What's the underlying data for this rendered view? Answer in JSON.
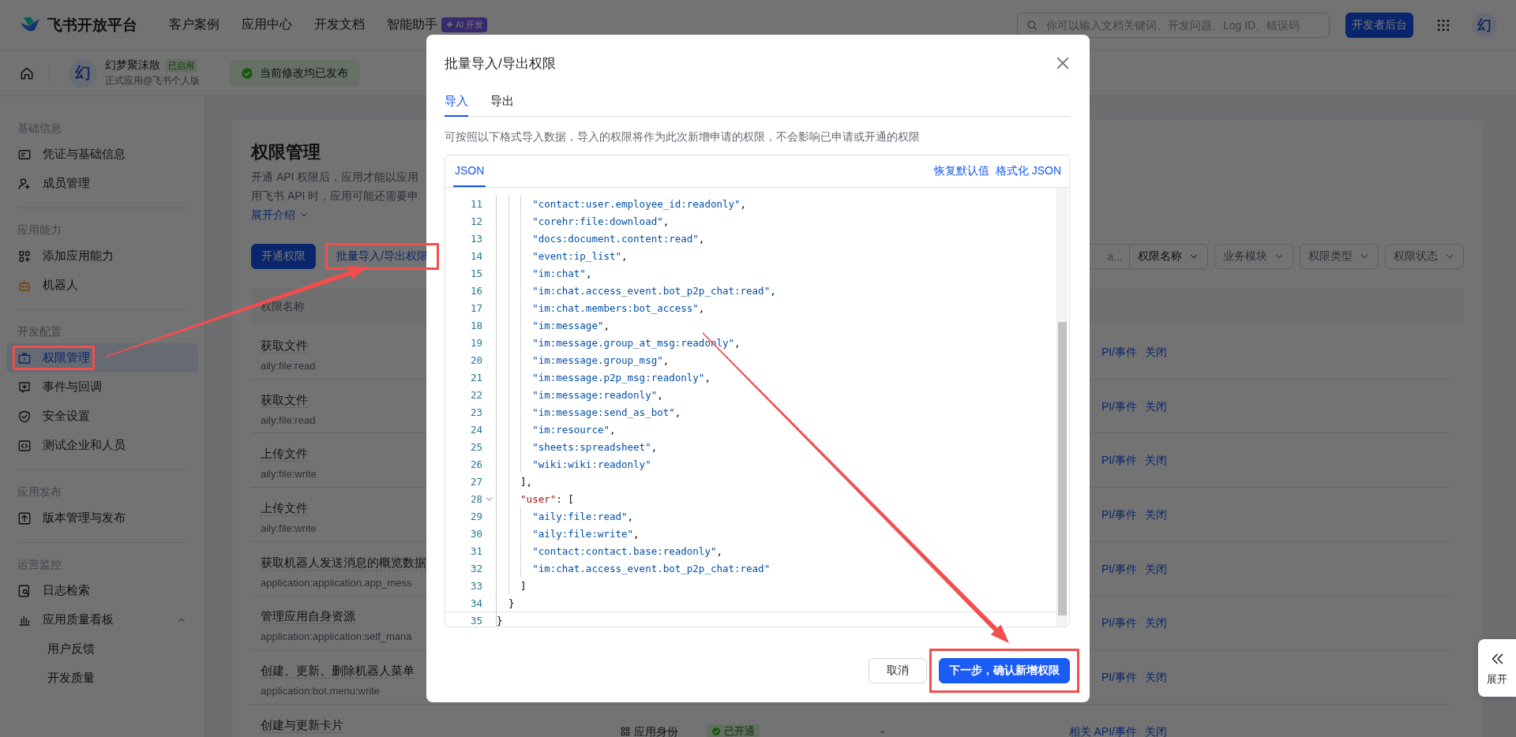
{
  "top_bar": {
    "logo": "飞书开放平台",
    "nav": [
      {
        "label": "客户案例"
      },
      {
        "label": "应用中心"
      },
      {
        "label": "开发文档"
      },
      {
        "label": "智能助手",
        "badge": "AI 开发"
      }
    ],
    "search": {
      "placeholder": "你可以输入文档关键词、开发问题、Log ID、错误码"
    },
    "console_button": "开发者后台",
    "avatar": "幻"
  },
  "app_bar": {
    "avatar": "幻",
    "name": "幻梦聚沫散",
    "status": "已启用",
    "subtitle": "正式应用@飞书个人版",
    "notice": "当前修改均已发布"
  },
  "sidebar": {
    "sections": [
      {
        "title": "基础信息",
        "items": [
          {
            "label": "凭证与基础信息",
            "selected": false,
            "highlighted": false
          },
          {
            "label": "成员管理",
            "selected": false,
            "highlighted": false
          }
        ]
      },
      {
        "title": "应用能力",
        "items": [
          {
            "label": "添加应用能力",
            "selected": false,
            "highlighted": false
          },
          {
            "label": "机器人",
            "selected": false,
            "highlighted": false
          }
        ]
      },
      {
        "title": "开发配置",
        "items": [
          {
            "label": "权限管理",
            "selected": true,
            "highlighted": true
          },
          {
            "label": "事件与回调",
            "selected": false,
            "highlighted": false
          },
          {
            "label": "安全设置",
            "selected": false,
            "highlighted": false
          },
          {
            "label": "测试企业和人员",
            "selected": false,
            "highlighted": false
          }
        ]
      },
      {
        "title": "应用发布",
        "items": [
          {
            "label": "版本管理与发布",
            "selected": false,
            "highlighted": false
          }
        ]
      },
      {
        "title": "运营监控",
        "items": [
          {
            "label": "日志检索",
            "selected": false,
            "highlighted": false
          },
          {
            "label": "应用质量看板",
            "selected": false,
            "highlighted": false,
            "expanded": true,
            "children": [
              {
                "label": "用户反馈",
                "selected": false
              },
              {
                "label": "开发质量",
                "selected": false
              }
            ]
          }
        ]
      }
    ]
  },
  "main": {
    "title": "权限管理",
    "description_lines": [
      "开通 API 权限后，应用才能以应用",
      "用飞书 API 时，应用可能还需要申"
    ],
    "expand_link": "展开介绍",
    "buttons": [
      {
        "label": "开通权限",
        "kind": "primary",
        "highlighted": false
      },
      {
        "label": "批量导入/导出权限",
        "kind": "outline",
        "highlighted": true
      }
    ],
    "filters": {
      "search_text": "a...",
      "dropdowns": [
        {
          "label": "权限名称",
          "kind": "attached"
        },
        {
          "label": "业务模块",
          "kind": "filter"
        },
        {
          "label": "权限类型",
          "kind": "filter"
        },
        {
          "label": "权限状态",
          "kind": "filter"
        }
      ]
    },
    "table": {
      "columns": [
        "权限名称"
      ],
      "rows": [
        {
          "title": "获取文件",
          "scope": "aily:file:read",
          "link": "PI/事件",
          "action": "关闭"
        },
        {
          "title": "获取文件",
          "scope": "aily:file:read",
          "link": "PI/事件",
          "action": "关闭"
        },
        {
          "title": "上传文件",
          "scope": "aily:file:write",
          "link": "PI/事件",
          "action": "关闭"
        },
        {
          "title": "上传文件",
          "scope": "aily:file:write",
          "link": "PI/事件",
          "action": "关闭"
        },
        {
          "title": "获取机器人发送消息的概览数据",
          "scope": "application:application.app_mess",
          "link": "PI/事件",
          "action": "关闭"
        },
        {
          "title": "管理应用自身资源",
          "scope": "application:application:self_mana",
          "link": "PI/事件",
          "action": "关闭"
        },
        {
          "title": "创建、更新、删除机器人菜单",
          "scope": "application:bot.menu:write",
          "link": "PI/事件",
          "action": "关闭"
        },
        {
          "title": "创建与更新卡片",
          "identity": "应用身份",
          "status": "已开通",
          "column_4": "-",
          "link": "相关 API/事件",
          "action": "关闭"
        }
      ]
    }
  },
  "modal": {
    "title": "批量导入/导出权限",
    "tabs": [
      {
        "label": "导入",
        "selected": true
      },
      {
        "label": "导出",
        "selected": false
      }
    ],
    "description": "可按照以下格式导入数据，导入的权限将作为此次新增申请的权限，不会影响已申请或开通的权限",
    "editor": {
      "tabs": [
        {
          "label": "JSON",
          "selected": true
        }
      ],
      "links": [
        "恢复默认值",
        "格式化 JSON"
      ],
      "lines": [
        {
          "number": "11",
          "text": "      \"contact:user.employee_id:readonly\","
        },
        {
          "number": "12",
          "text": "      \"corehr:file:download\","
        },
        {
          "number": "13",
          "text": "      \"docs:document.content:read\","
        },
        {
          "number": "14",
          "text": "      \"event:ip_list\","
        },
        {
          "number": "15",
          "text": "      \"im:chat\","
        },
        {
          "number": "16",
          "text": "      \"im:chat.access_event.bot_p2p_chat:read\","
        },
        {
          "number": "17",
          "text": "      \"im:chat.members:bot_access\","
        },
        {
          "number": "18",
          "text": "      \"im:message\","
        },
        {
          "number": "19",
          "text": "      \"im:message.group_at_msg:readonly\","
        },
        {
          "number": "20",
          "text": "      \"im:message.group_msg\","
        },
        {
          "number": "21",
          "text": "      \"im:message.p2p_msg:readonly\","
        },
        {
          "number": "22",
          "text": "      \"im:message:readonly\","
        },
        {
          "number": "23",
          "text": "      \"im:message:send_as_bot\","
        },
        {
          "number": "24",
          "text": "      \"im:resource\","
        },
        {
          "number": "25",
          "text": "      \"sheets:spreadsheet\","
        },
        {
          "number": "26",
          "text": "      \"wiki:wiki:readonly\""
        },
        {
          "number": "27",
          "text": "    ],"
        },
        {
          "number": "28",
          "text": "    \"user\": [",
          "foldable": true
        },
        {
          "number": "29",
          "text": "      \"aily:file:read\","
        },
        {
          "number": "30",
          "text": "      \"aily:file:write\","
        },
        {
          "number": "31",
          "text": "      \"contact:contact.base:readonly\","
        },
        {
          "number": "32",
          "text": "      \"im:chat.access_event.bot_p2p_chat:read\""
        },
        {
          "number": "33",
          "text": "    ]"
        },
        {
          "number": "34",
          "text": "  }"
        },
        {
          "number": "35",
          "text": "}",
          "current": true
        }
      ]
    },
    "buttons": [
      {
        "label": "取消",
        "kind": "secondary",
        "highlighted": false
      },
      {
        "label": "下一步，确认新增权限",
        "kind": "primary",
        "highlighted": true
      }
    ]
  },
  "expand_button": "展开",
  "annotations": [
    {
      "kind": "arrow"
    },
    {
      "kind": "arrow"
    }
  ]
}
